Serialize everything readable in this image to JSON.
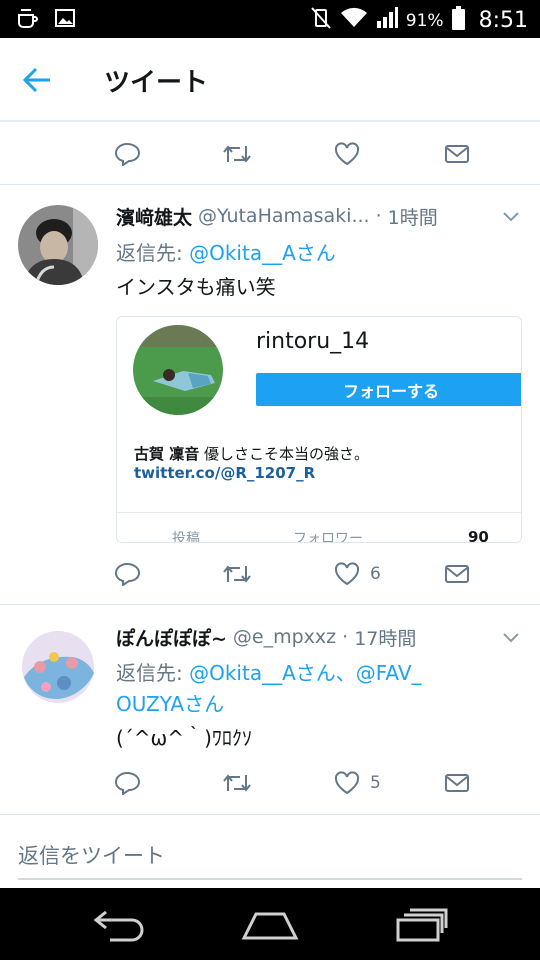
{
  "status_bar": {
    "battery_text": "91%",
    "time": "8:51"
  },
  "app_bar": {
    "title": "ツイート"
  },
  "tweet1": {
    "display_name": "濱﨑雄太",
    "handle": "@YutaHamasaki...",
    "separator": "·",
    "time": "1時間",
    "reply_prefix": "返信先: ",
    "reply_mentions": "@Okita__Aさん",
    "text": "インスタも痛い笑",
    "like_count": "6",
    "card": {
      "username": "rintoru_14",
      "follow_label": "フォローする",
      "bio_name": "古賀 凜音",
      "bio_text": " 優しさこそ本当の強さ。",
      "link": "twitter.co/@R_1207_R",
      "stat_posts_label": "投稿",
      "stat_followers_label": "フォロワー",
      "stat_value": "90"
    }
  },
  "tweet2": {
    "display_name": "ぽんぽぽぽ~",
    "handle": "@e_mpxxz",
    "separator": "·",
    "time": "17時間",
    "reply_prefix": "返信先: ",
    "reply_mentions_line1": "@Okita__Aさん、@FAV_",
    "reply_mentions_line2": "OUZYAさん",
    "text": "(´^ω^｀)ﾜﾛｸｿ",
    "like_count": "5"
  },
  "compose": {
    "placeholder": "返信をツイート"
  },
  "colors": {
    "accent": "#1da1f2",
    "icon_gray": "#657786",
    "divider": "#e1e8ed"
  }
}
